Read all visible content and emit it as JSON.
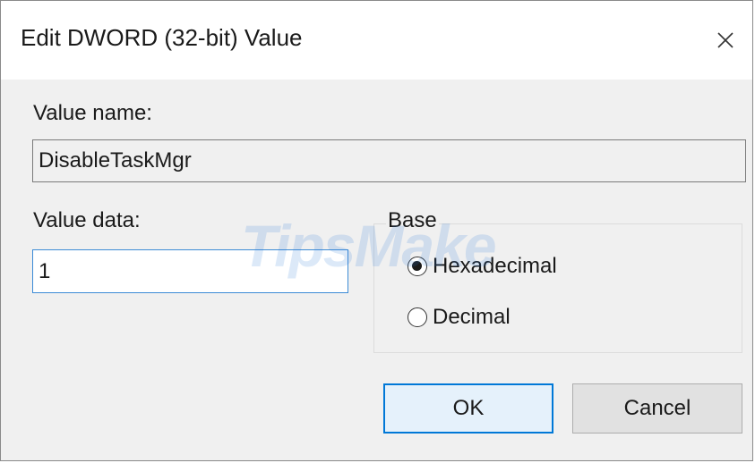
{
  "dialog": {
    "title": "Edit DWORD (32-bit) Value",
    "close_icon": "close-icon"
  },
  "value_name": {
    "label": "Value name:",
    "value": "DisableTaskMgr"
  },
  "value_data": {
    "label": "Value data:",
    "value": "1"
  },
  "base": {
    "legend": "Base",
    "options": [
      {
        "label": "Hexadecimal",
        "checked": true
      },
      {
        "label": "Decimal",
        "checked": false
      }
    ]
  },
  "buttons": {
    "ok": "OK",
    "cancel": "Cancel"
  },
  "watermark": "TipsMake",
  "colors": {
    "accent": "#0078d7",
    "dialog_bg": "#f0f0f0"
  }
}
